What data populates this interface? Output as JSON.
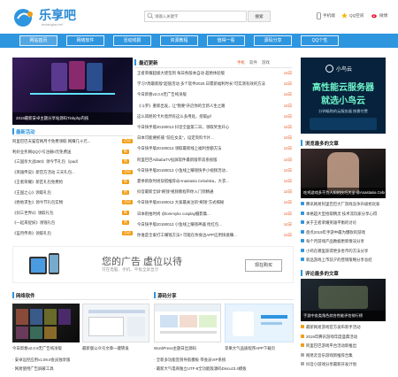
{
  "logo": {
    "text": "乐享吧",
    "url": "lexiangba.net"
  },
  "search": {
    "placeholder": "请输入关键字",
    "button": "搜索"
  },
  "top_links": {
    "mobile": "手机端",
    "qzone": "QQ空间",
    "weibo": "微博"
  },
  "nav": [
    "网站首页",
    "网络软件",
    "活动线报",
    "资源教程",
    "值得一看",
    "源码分享",
    "QQ个性"
  ],
  "featured": {
    "caption": "2019最新安卓主题分享站源码Tinkphp内核"
  },
  "left_activity": {
    "title": "最新活动",
    "items": [
      {
        "text": "阿里巴巴天猫官网月卡免费领取 网赚几十元...",
        "tag": ""
      },
      {
        "text": "利好业务网QQ小号注册0元免费送",
        "tag": ""
      },
      {
        "text": "《三国杀大战360》领今节礼包（ipad）",
        "tag": ""
      },
      {
        "text": "《英雄传说》新官方活动 三天礼包...",
        "tag": ""
      },
      {
        "text": "《王者荣耀》新区礼包免费抢",
        "tag": ""
      },
      {
        "text": "《王国之心》领取礼包",
        "tag": ""
      },
      {
        "text": "《绝地求生》领今节礼包实物",
        "tag": ""
      },
      {
        "text": "《剑三世界2》领取礼包",
        "tag": ""
      },
      {
        "text": "《一起来捉妖》领钱礼包",
        "tag": ""
      },
      {
        "text": "《蓝月传奇》领取礼包",
        "tag": ""
      }
    ],
    "tags": [
      "活动",
      "新",
      "热",
      "活动",
      "新",
      "热",
      "活动",
      "新",
      "热",
      "活动"
    ]
  },
  "latest": {
    "title": "最近更新",
    "tabs": [
      "手机",
      "软件",
      "游戏"
    ],
    "items": [
      {
        "text": "王者荣耀超极大佬签到 每日各版本自动 超绝体验版",
        "date": "14日"
      },
      {
        "text": "学习7周最新版“超值活动 多个软件2020.日累新福利时长”可实测有效的方法",
        "date": "14日"
      },
      {
        "text": "今日新春v2.0.9无广告纯净版",
        "date": "14日"
      },
      {
        "text": "《斗罗》重新出发，让“我要”开启你的全新人生之路",
        "date": "14日"
      },
      {
        "text": "这么简陋的卡片竟然有这么多用处，捞取gif",
        "date": "14日"
      },
      {
        "text": "今日快手版20190013 抖音全面第二日，领取奖金开心",
        "date": "14日"
      },
      {
        "text": "日本可能要抓捕 “前任女友”，设定资料卡片...",
        "date": "14日"
      },
      {
        "text": "今日快手版20190013 领取最新线上福利金额方法",
        "date": "14日"
      },
      {
        "text": "阿里巴巴AlibabaTV投屏软件最新版带双系统版",
        "date": "14日"
      },
      {
        "text": "今日快手版20190013 小鱼线上赚钱快手小视频活动...",
        "date": "14日"
      },
      {
        "text": "夏季新款时尚穿搭推荐@Anastasia Cebulska，大衣...",
        "date": "14日"
      },
      {
        "text": "抖音最新全屏“刷钱”视频教程带你入门到精通",
        "date": "14日"
      },
      {
        "text": "今日快手版20190013 大家最关注的“刷钱”方式揭秘",
        "date": "14日"
      },
      {
        "text": "日本街拍时尚 @tommyko cosplay摄影集...",
        "date": "14日"
      },
      {
        "text": "今日快手版20190013 小鱼线上赚钱神器 抢红包...",
        "date": "14日"
      },
      {
        "text": "你谁是全家打工赚钱方法? 可能在你身边APP应用快速赚...",
        "date": "14日"
      }
    ]
  },
  "right_ad": {
    "brand": "小鸟云",
    "headline": "高性能云服务器",
    "sub": "就选小鸟云",
    "note": "分钟级购的云服务器 按需付费"
  },
  "right_hot": {
    "title": "浏览最多的文章",
    "caption": "吃鸡游戏多不为人知的技巧大全 @Anastasia Cebulska",
    "items": [
      "腾讯网易阿里巴巴大厂游戏竞争升级抢玩家",
      "本格超大型拾取精灵 技术流玩家分享心得",
      "关于王者荣耀英雄平衡的讨论",
      "盘点2019年手游中最为爆款的游戏",
      "每个月游戏产品数据更新情况分享",
      "小鸡在哪里获得更多金币的方法分享",
      "新品游戏上市前夕的营销策略分享总结"
    ]
  },
  "right_comments": {
    "title": "评论最多的文章",
    "caption": "手游中各类角色综合性能评估排行榜",
    "items": [
      "最新网易游戏官方发布新手活动",
      "2019年腾讯游戏年度盛典活动",
      "阿里巴巴游戏平台活动新推出",
      "网易云音乐游戏新推荐合集",
      "抖音小游戏分享最新开发计划"
    ]
  },
  "ad_banner": {
    "title": "您的广告 虚位以待",
    "sub": "可在电脑、手机、平板全屏显示",
    "button": "现在购买"
  },
  "software": {
    "title": "网络软件",
    "items": [
      {
        "caption": "今日新春v2.0.9无广告纯净版",
        "date": "14日"
      },
      {
        "caption": "最新版公众号文章一键转发",
        "date": "14日"
      }
    ],
    "list": [
      "安卓远控应用v1.09.0会员独享版",
      "网易使用广告屏蔽工具"
    ]
  },
  "source": {
    "title": "源码分享",
    "items": [
      {
        "caption": "WordPress主题日出源码"
      },
      {
        "caption": "苹果大气品质程序APP下载页"
      }
    ],
    "list": [
      "全新多功能签到导航模板 带会员VIP系统",
      "最新大气电商独立UTF-8全功能版源码Discuz3.4模板"
    ]
  }
}
